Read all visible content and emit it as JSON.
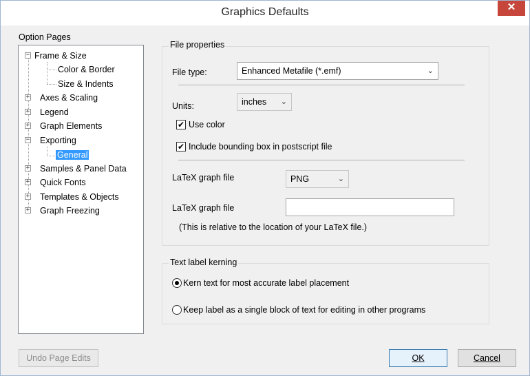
{
  "window": {
    "title": "Graphics Defaults",
    "close_glyph": "✕"
  },
  "option_pages": {
    "label": "Option Pages",
    "items": [
      {
        "label": "Frame & Size",
        "expanded": true
      },
      {
        "label": "Color & Border"
      },
      {
        "label": "Size & Indents"
      },
      {
        "label": "Axes & Scaling",
        "expanded": false
      },
      {
        "label": "Legend",
        "expanded": false
      },
      {
        "label": "Graph Elements",
        "expanded": false
      },
      {
        "label": "Exporting",
        "expanded": true
      },
      {
        "label": "General",
        "selected": true
      },
      {
        "label": "Samples & Panel Data",
        "expanded": false
      },
      {
        "label": "Quick Fonts",
        "expanded": false
      },
      {
        "label": "Templates & Objects",
        "expanded": false
      },
      {
        "label": "Graph Freezing",
        "expanded": false
      }
    ],
    "expanded_glyph": "−",
    "collapsed_glyph": "+"
  },
  "file_properties": {
    "group_label": "File properties",
    "file_type_label": "File type:",
    "file_type_value": "Enhanced Metafile (*.emf)",
    "units_label": "Units:",
    "units_value": "inches",
    "use_color_label": "Use color",
    "use_color_checked": true,
    "bounding_box_label": "Include bounding box in postscript file",
    "bounding_box_checked": true,
    "latex_format_label": "LaTeX graph file",
    "latex_format_value": "PNG",
    "latex_path_label": "LaTeX graph file",
    "latex_path_value": "",
    "latex_note": "(This is relative to the location of your LaTeX file.)",
    "check_glyph": "✔",
    "dropdown_glyph": "⌄"
  },
  "kerning": {
    "group_label": "Text label kerning",
    "option_kern": "Kern text for most accurate label placement",
    "option_block": "Keep label as a single block of text for editing in other programs",
    "selected": "kern"
  },
  "buttons": {
    "undo": "Undo Page Edits",
    "ok": "OK",
    "cancel": "Cancel"
  },
  "colors": {
    "selection": "#3399ff",
    "close_button": "#c7463b",
    "dialog_background": "#f0f0f0"
  }
}
